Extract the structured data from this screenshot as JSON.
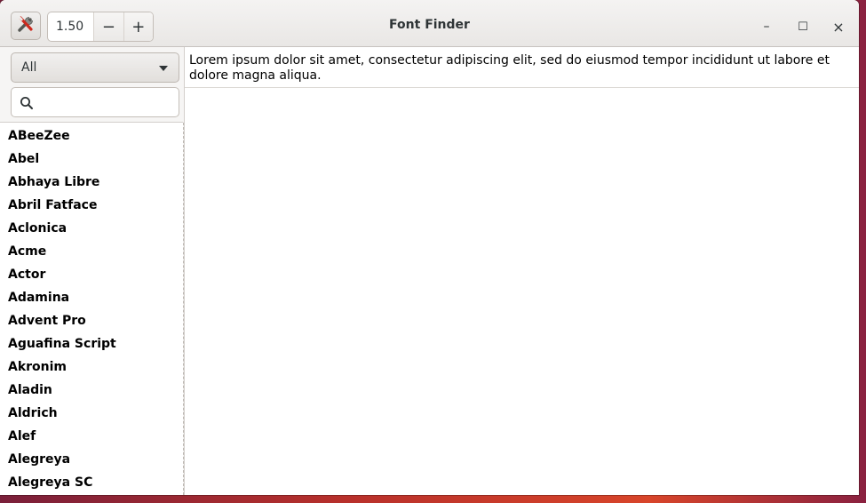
{
  "window": {
    "title": "Font Finder",
    "minimize_glyph": "–",
    "maximize_glyph": "☐",
    "close_glyph": "×"
  },
  "toolbar": {
    "app_icon": "wrench-screwdriver-icon",
    "size_value": "1.50",
    "decrease_label": "−",
    "increase_label": "+"
  },
  "sidebar": {
    "filter_selected": "All",
    "search_placeholder": "",
    "fonts": [
      "ABeeZee",
      "Abel",
      "Abhaya Libre",
      "Abril Fatface",
      "Aclonica",
      "Acme",
      "Actor",
      "Adamina",
      "Advent Pro",
      "Aguafina Script",
      "Akronim",
      "Aladin",
      "Aldrich",
      "Alef",
      "Alegreya",
      "Alegreya SC"
    ]
  },
  "main": {
    "preview_text": "Lorem ipsum dolor sit amet, consectetur adipiscing elit, sed do eiusmod tempor incididunt ut labore et dolore magna aliqua."
  },
  "colors": {
    "accent": "#e95420",
    "text": "#2e3436"
  }
}
